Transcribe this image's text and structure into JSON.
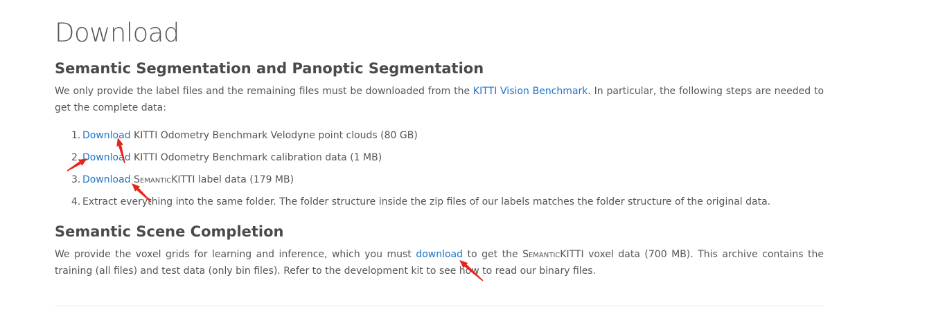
{
  "page_title": "Download",
  "section1": {
    "heading": "Semantic Segmentation and Panoptic Segmentation",
    "intro_before": "We only provide the label files and the remaining files must be downloaded from the ",
    "intro_link": "KITTI Vision Benchmark",
    "intro_after": ". In particular, the following steps are needed to get the complete data:",
    "steps": [
      {
        "num": "1.",
        "link": "Download",
        "text": " KITTI Odometry Benchmark Velodyne point clouds (80 GB)"
      },
      {
        "num": "2.",
        "link": "Download",
        "text": " KITTI Odometry Benchmark calibration data (1 MB)"
      },
      {
        "num": "3.",
        "link": "Download",
        "sc": "SemanticKITTI",
        "text": " label data (179 MB)"
      },
      {
        "num": "4.",
        "text": "Extract everything into the same folder. The folder structure inside the zip files of our labels matches the folder structure of the original data."
      }
    ]
  },
  "section2": {
    "heading": "Semantic Scene Completion",
    "before": "We provide the voxel grids for learning and inference, which you must ",
    "link": "download",
    "middle": " to get the ",
    "sc": "SemanticKITTI",
    "after": " voxel data (700 MB). This archive contains the training (all files) and test data (only bin files). Refer to the development kit to see how to read our binary files."
  },
  "annotation_color": "#e8231b"
}
